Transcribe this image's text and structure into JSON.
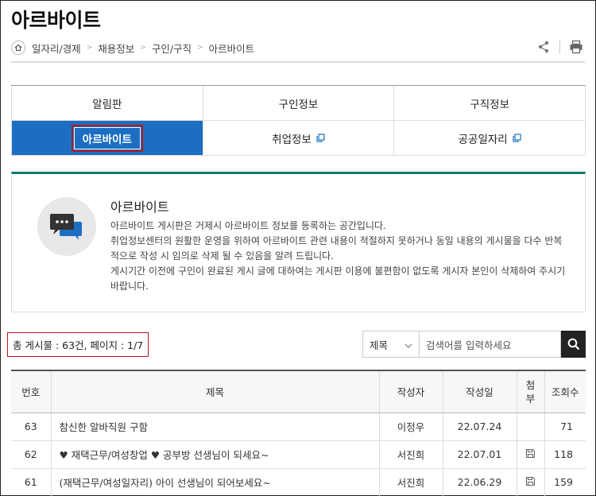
{
  "page": {
    "title": "아르바이트"
  },
  "breadcrumb": [
    "일자리/경제",
    "채용정보",
    "구인/구직",
    "아르바이트"
  ],
  "tools": {
    "share_icon": "share-icon",
    "print_icon": "print-icon"
  },
  "tabs": {
    "row1": [
      "알림판",
      "구인정보",
      "구직정보"
    ],
    "row2": [
      {
        "label": "아르바이트",
        "active": true
      },
      {
        "label": "취업정보",
        "external": true
      },
      {
        "label": "공공일자리",
        "external": true
      }
    ]
  },
  "info": {
    "title": "아르바이트",
    "lines": [
      "아르바이트 게시판은 거제시 아르바이트 정보를 등록하는 공간입니다.",
      "취업정보센터의 원활한 운영을 위하여 아르바이트 관련 내용이 적절하지 못하거나 동일 내용의 게시물을 다수 반복 적으로 작성 시 임의로 삭제 될 수 있음을 알려 드립니다.",
      "게시기간 이전에 구인이 완료된 게시 글에 대하여는 게시판 이용에 불편함이 없도록 게시자 본인이 삭제하여 주시기 바랍니다."
    ]
  },
  "stats": {
    "text": "총 게시물 : 63건, 페이지 : 1/7"
  },
  "search": {
    "field": "제목",
    "placeholder": "검색어를 입력하세요"
  },
  "table": {
    "headers": [
      "번호",
      "제목",
      "작성자",
      "작성일",
      "첨부",
      "조회수"
    ],
    "rows": [
      {
        "no": "63",
        "title": "참신한 알바직원 구함",
        "author": "이정우",
        "date": "22.07.24",
        "attach": false,
        "views": "71"
      },
      {
        "no": "62",
        "title": "♥ 재택근무/여성창업 ♥ 공부방 선생님이 되세요~",
        "author": "서진희",
        "date": "22.07.01",
        "attach": true,
        "views": "118"
      },
      {
        "no": "61",
        "title": "(재택근무/여성일자리) 아이 선생님이 되어보세요~",
        "author": "서진희",
        "date": "22.06.29",
        "attach": true,
        "views": "159"
      }
    ]
  }
}
